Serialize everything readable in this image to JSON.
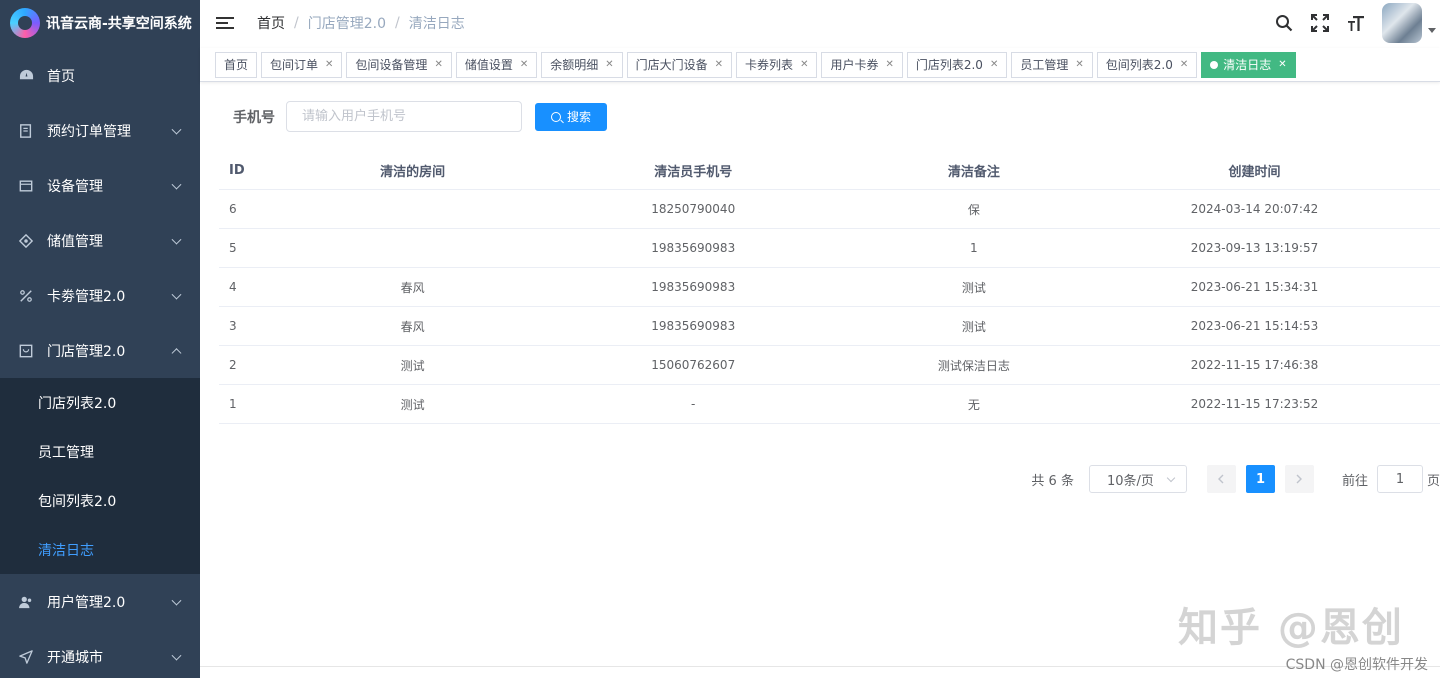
{
  "app": {
    "title": "讯音云商-共享空间系统"
  },
  "sidebar": {
    "items": [
      {
        "label": "首页",
        "icon": "dashboard-icon"
      },
      {
        "label": "预约订单管理",
        "icon": "order-icon"
      },
      {
        "label": "设备管理",
        "icon": "device-icon"
      },
      {
        "label": "储值管理",
        "icon": "wallet-icon"
      },
      {
        "label": "卡劵管理2.0",
        "icon": "coupon-icon"
      },
      {
        "label": "门店管理2.0",
        "icon": "store-icon"
      },
      {
        "label": "用户管理2.0",
        "icon": "user-icon"
      },
      {
        "label": "开通城市",
        "icon": "send-icon"
      }
    ],
    "store_submenu": [
      {
        "label": "门店列表2.0"
      },
      {
        "label": "员工管理"
      },
      {
        "label": "包间列表2.0"
      },
      {
        "label": "清洁日志"
      }
    ]
  },
  "navbar": {
    "breadcrumb": [
      "首页",
      "门店管理2.0",
      "清洁日志"
    ],
    "separator": "/"
  },
  "tags": [
    {
      "label": "首页"
    },
    {
      "label": "包间订单"
    },
    {
      "label": "包间设备管理"
    },
    {
      "label": "储值设置"
    },
    {
      "label": "余额明细"
    },
    {
      "label": "门店大门设备"
    },
    {
      "label": "卡券列表"
    },
    {
      "label": "用户卡券"
    },
    {
      "label": "门店列表2.0"
    },
    {
      "label": "员工管理"
    },
    {
      "label": "包间列表2.0"
    },
    {
      "label": "清洁日志"
    }
  ],
  "search": {
    "label": "手机号",
    "placeholder": "请输入用户手机号",
    "button": "搜索"
  },
  "table": {
    "headers": [
      "ID",
      "清洁的房间",
      "清洁员手机号",
      "清洁备注",
      "创建时间"
    ],
    "rows": [
      [
        "6",
        "",
        "18250790040",
        "保",
        "2024-03-14 20:07:42"
      ],
      [
        "5",
        "",
        "19835690983",
        "1",
        "2023-09-13 13:19:57"
      ],
      [
        "4",
        "春风",
        "19835690983",
        "测试",
        "2023-06-21 15:34:31"
      ],
      [
        "3",
        "春风",
        "19835690983",
        "测试",
        "2023-06-21 15:14:53"
      ],
      [
        "2",
        "测试",
        "15060762607",
        "测试保洁日志",
        "2022-11-15 17:46:38"
      ],
      [
        "1",
        "测试",
        "-",
        "无",
        "2022-11-15 17:23:52"
      ]
    ]
  },
  "pagination": {
    "total": "共 6 条",
    "page_size": "10条/页",
    "current": "1",
    "goto_prefix": "前往",
    "goto_value": "1",
    "goto_suffix": "页"
  },
  "watermark": "知乎 @恩创",
  "footer_watermark": "CSDN @恩创软件开发",
  "colors": {
    "sidebar_bg": "#304156",
    "submenu_bg": "#1f2d3d",
    "accent": "#1890ff",
    "active_tag": "#42b983",
    "submenu_active": "#409eff"
  }
}
